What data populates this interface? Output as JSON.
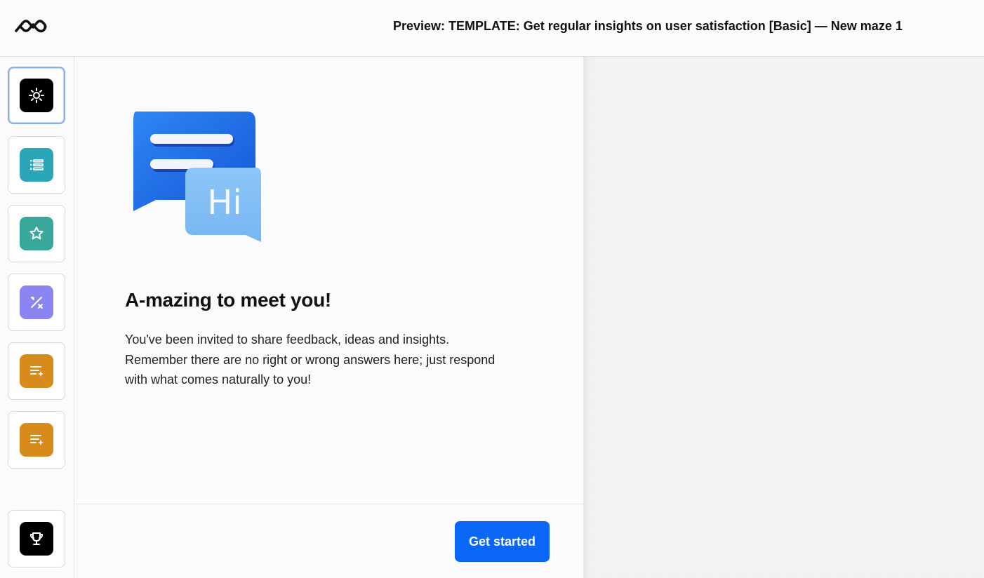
{
  "header": {
    "title": "Preview: TEMPLATE: Get regular insights on user satisfaction [Basic] — New maze 1",
    "logo_icon": "maze-logo-icon"
  },
  "sidebar": {
    "steps": [
      {
        "name": "welcome",
        "icon": "gear-icon",
        "color": "#000000",
        "active": true
      },
      {
        "name": "list-question",
        "icon": "list-icon",
        "color": "#2aa6b8",
        "active": false
      },
      {
        "name": "rating",
        "icon": "star-icon",
        "color": "#3aa79b",
        "active": false
      },
      {
        "name": "magic",
        "icon": "wand-icon",
        "color": "#8b85f2",
        "active": false
      },
      {
        "name": "open-question-1",
        "icon": "text-sparkle-icon",
        "color": "#d88b1d",
        "active": false
      },
      {
        "name": "open-question-2",
        "icon": "text-sparkle-icon",
        "color": "#d88b1d",
        "active": false
      },
      {
        "name": "thank-you",
        "icon": "trophy-icon",
        "color": "#000000",
        "active": false
      }
    ]
  },
  "main": {
    "illustration_icon": "chat-bubbles-icon",
    "illustration_text": "Hi",
    "title": "A-mazing to meet you!",
    "body_lines": [
      "You've been invited to share feedback, ideas and insights.",
      "Remember there are no right or wrong answers here; just respond",
      "with what comes naturally to you!"
    ],
    "cta_label": "Get started"
  },
  "colors": {
    "accent": "#0a66f5",
    "background": "#fbfbfd"
  }
}
